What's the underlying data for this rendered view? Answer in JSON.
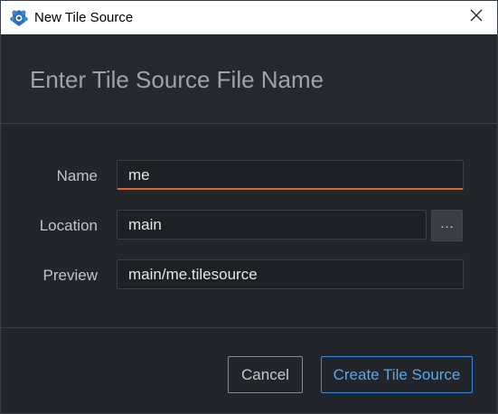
{
  "window": {
    "title": "New Tile Source",
    "icon": "defold-app-icon",
    "close_icon": "close-icon"
  },
  "header": {
    "title": "Enter Tile Source File Name"
  },
  "form": {
    "name": {
      "label": "Name",
      "value": "me"
    },
    "location": {
      "label": "Location",
      "value": "main",
      "browse_label": "…"
    },
    "preview": {
      "label": "Preview",
      "value": "main/me.tilesource"
    }
  },
  "buttons": {
    "cancel": "Cancel",
    "create": "Create Tile Source"
  },
  "colors": {
    "accent_focus": "#e0642c",
    "primary_button": "#56a8ee",
    "background": "#22252a"
  }
}
